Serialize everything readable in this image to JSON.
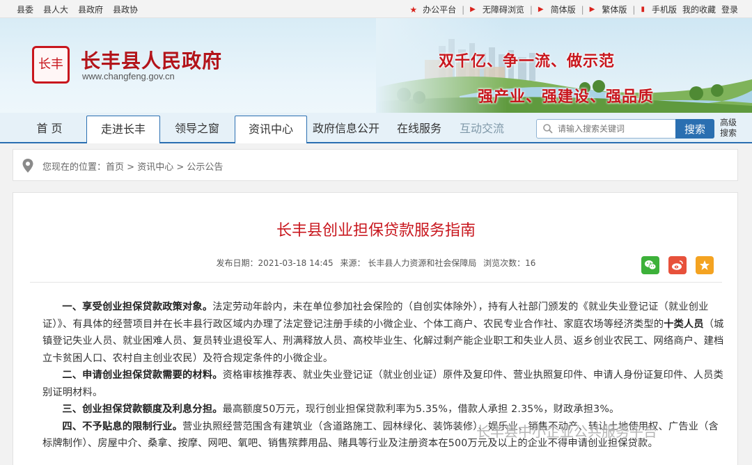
{
  "topbar": {
    "left_links": [
      "县委",
      "县人大",
      "县政府",
      "县政协"
    ],
    "right_links": [
      "办公平台",
      "无障碍浏览",
      "简体版",
      "繁体版",
      "手机版",
      "我的收藏",
      "登录"
    ]
  },
  "header": {
    "logo_text": "长丰",
    "site_title": "长丰县人民政府",
    "site_url": "www.changfeng.gov.cn",
    "slogan_1": "双千亿、争一流、做示范",
    "slogan_2": "强产业、强建设、强品质"
  },
  "nav": {
    "items": [
      "首 页",
      "走进长丰",
      "领导之窗",
      "资讯中心",
      "政府信息公开",
      "在线服务",
      "互动交流"
    ],
    "search_placeholder": "请输入搜索关键词",
    "search_button": "搜索",
    "advanced_search": "高级搜索"
  },
  "breadcrumb": {
    "prefix": "您现在的位置：",
    "items": [
      "首页",
      "资讯中心",
      "公示公告"
    ]
  },
  "article": {
    "title": "长丰县创业担保贷款服务指南",
    "publish_date": "发布日期：2021-03-18 14:45",
    "source": "来源：  长丰县人力资源和社会保障局",
    "views": "浏览次数：16",
    "p1_heading": "一、享受创业担保贷款政策对象。",
    "p1_a": "法定劳动年龄内，未在单位参加社会保险的（自创实体除外），持有人社部门颁发的《就业失业登记证（就业创业证）》、有具体的经营项目并在长丰县行政区域内办理了法定登记注册手续的小微企业、个体工商户、农民专业合作社、家庭农场等经济类型的",
    "p1_bold": "十类人员",
    "p1_b": "（城镇登记失业人员、就业困难人员、复员转业退役军人、刑满释放人员、高校毕业生、化解过剩产能企业职工和失业人员、返乡创业农民工、网络商户、建档立卡贫困人口、农村自主创业农民）及符合规定条件的小微企业。",
    "p2_heading": "二、申请创业担保贷款需要的材料。",
    "p2_text": "资格审核推荐表、就业失业登记证（就业创业证）原件及复印件、营业执照复印件、申请人身份证复印件、人员类别证明材料。",
    "p3_heading": "三、创业担保贷款额度及利息分担。",
    "p3_text": "最高额度50万元，现行创业担保贷款利率为5.35%，借款人承担 2.35%，财政承担3%。",
    "p4_heading": "四、不予贴息的限制行业。",
    "p4_text": "营业执照经营范围含有建筑业（含道路施工、园林绿化、装饰装修）、娱乐业、销售不动产、转让土地使用权、广告业（含标牌制作）、房屋中介、桑拿、按摩、网吧、氧吧、销售殡葬用品、赌具等行业及注册资本在500万元及以上的企业不得申请创业担保贷款。"
  },
  "watermark": "长丰县中小企业公共服务平台",
  "colors": {
    "brand_red": "#c8161d",
    "nav_blue": "#2a6fb1",
    "wechat_green": "#3db13a",
    "weibo_red": "#e7513b",
    "fav_orange": "#f4a321"
  }
}
